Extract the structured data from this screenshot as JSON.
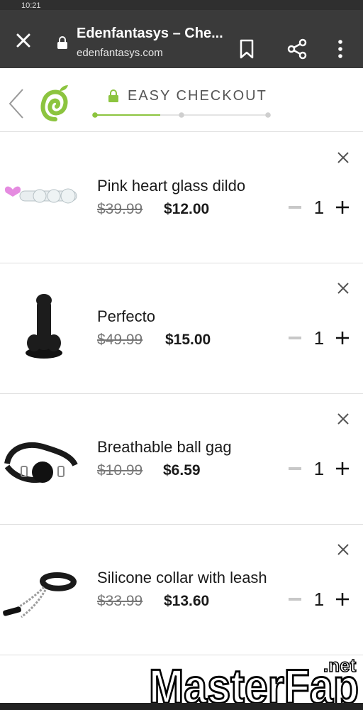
{
  "status": {
    "time": "10:21"
  },
  "browser": {
    "title": "Edenfantasys – Che...",
    "url": "edenfantasys.com"
  },
  "checkout": {
    "title": "EASY CHECKOUT"
  },
  "items": [
    {
      "name": "Pink heart glass dildo",
      "old_price": "$39.99",
      "price": "$12.00",
      "qty": "1"
    },
    {
      "name": "Perfecto",
      "old_price": "$49.99",
      "price": "$15.00",
      "qty": "1"
    },
    {
      "name": "Breathable ball gag",
      "old_price": "$10.99",
      "price": "$6.59",
      "qty": "1"
    },
    {
      "name": "Silicone collar with leash",
      "old_price": "$33.99",
      "price": "$13.60",
      "qty": "1"
    }
  ],
  "watermark": {
    "text": "MasterFap",
    "suffix": ".net"
  },
  "colors": {
    "accent": "#8cc43f",
    "chrome": "#3a3a3a"
  }
}
